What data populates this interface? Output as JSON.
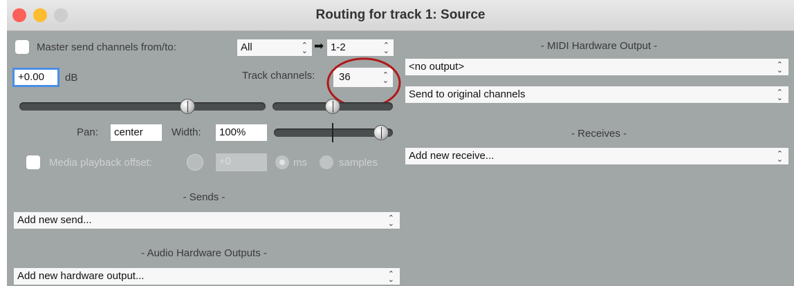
{
  "window": {
    "title": "Routing for track 1: Source"
  },
  "master_send": {
    "label": "Master send channels from/to:",
    "from_value": "All",
    "arrow": "➡",
    "to_value": "1-2"
  },
  "volume": {
    "value": "+0.00",
    "unit": "dB",
    "fader_level": 0.71
  },
  "track_channels": {
    "label": "Track channels:",
    "value": "36"
  },
  "pan": {
    "label": "Pan:",
    "value": "center",
    "slider_level": 0.5
  },
  "width": {
    "label": "Width:",
    "value": "100%",
    "slider_level": 1.0
  },
  "media_offset": {
    "label": "Media playback offset:",
    "value": "+0",
    "unit_ms": "ms",
    "unit_samples": "samples"
  },
  "sends": {
    "heading": "- Sends -",
    "dropdown": "Add new send..."
  },
  "audio_hw": {
    "heading": "- Audio Hardware Outputs -",
    "dropdown": "Add new hardware output..."
  },
  "midi_hw": {
    "heading": "- MIDI Hardware Output -",
    "output": "<no output>",
    "channel_mode": "Send to original channels"
  },
  "receives": {
    "heading": "- Receives -",
    "dropdown": "Add new receive..."
  },
  "icons": {
    "dropdown": "⌃⌄",
    "stepper": "⌃⌄"
  },
  "colors": {
    "close": "#fe5f57",
    "minimize": "#febc2e",
    "zoom": "#c8c8c8",
    "panel": "#a1a6a6",
    "highlight_ring": "#b01818",
    "focus_border": "#4a8ee6"
  }
}
